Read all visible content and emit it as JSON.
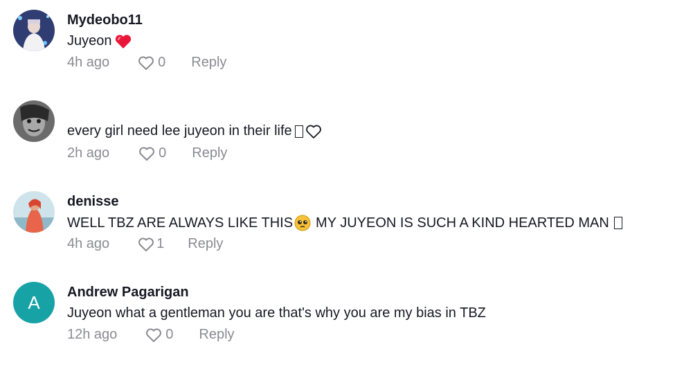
{
  "comments": [
    {
      "username": "Mydeobo11",
      "text": "Juyeon",
      "text_emoji": "heart-red",
      "time": "4h ago",
      "likes": "0",
      "reply": "Reply",
      "avatar": "photo"
    },
    {
      "username": "",
      "text": "every girl need lee juyeon in their life",
      "text_emoji": "tofu+heart-outline",
      "time": "2h ago",
      "likes": "0",
      "reply": "Reply",
      "avatar": "photo"
    },
    {
      "username": "denisse",
      "text_part1": "WELL TBZ ARE ALWAYS LIKE THIS",
      "text_emoji": "pleading-face",
      "text_part2": "MY JUYEON IS SUCH A KIND HEARTED MAN",
      "time": "4h ago",
      "likes": "1",
      "reply": "Reply",
      "avatar": "photo"
    },
    {
      "username": "Andrew Pagarigan",
      "text": "Juyeon what a gentleman you are that's why you are my bias in TBZ",
      "time": "12h ago",
      "likes": "0",
      "reply": "Reply",
      "avatar_letter": "A",
      "avatar_color": "#17a3a6"
    }
  ],
  "colors": {
    "text": "#161823",
    "muted": "#8a8b91",
    "heart_red": "#e8173a"
  }
}
